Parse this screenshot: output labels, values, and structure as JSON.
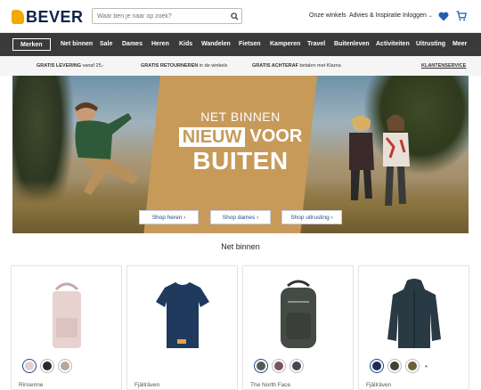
{
  "header": {
    "logo_text": "BEVER",
    "search_placeholder": "Waar ben je naar op zoek?",
    "links": [
      "Onze winkels",
      "Advies & Inspiratie",
      "Inloggen"
    ],
    "icons": [
      "search-icon",
      "heart-icon",
      "cart-icon",
      "chevron-down-icon"
    ]
  },
  "mainnav": {
    "merken": "Merken",
    "items": [
      "Net binnen",
      "Sale",
      "Dames",
      "Heren",
      "Kids",
      "Wandelen",
      "Fietsen",
      "Kamperen",
      "Travel",
      "Buitenleven",
      "Activiteiten",
      "Uitrusting",
      "Meer"
    ]
  },
  "infobar": {
    "items": [
      {
        "bold": "GRATIS LEVERING",
        "rest": " vanaf 25,-"
      },
      {
        "bold": "GRATIS RETOURNEREN",
        "rest": " in de winkels"
      },
      {
        "bold": "GRATIS ACHTERAF",
        "rest": " betalen met Klarna"
      }
    ],
    "service": "KLANTENSERVICE"
  },
  "hero": {
    "line1": "NET BINNEN",
    "nieuw": "NIEUW",
    "voor": "VOOR",
    "line3": "BUITEN",
    "buttons": [
      "Shop heren ›",
      "Shop dames ›",
      "Shop uitrusting ›"
    ]
  },
  "products": {
    "title": "Net binnen",
    "cards": [
      {
        "brand": "Rinsenne",
        "image": "backpack-tote",
        "color": "#e8d2cf",
        "swatches": [
          "#e3cdcd",
          "#2a2a2a",
          "#b8a79b"
        ]
      },
      {
        "brand": "Fjällräven",
        "image": "t-shirt",
        "color": "#1f3a5c",
        "swatches": []
      },
      {
        "brand": "The North Face",
        "image": "backpack",
        "color": "#444a44",
        "swatches": [
          "#555a55",
          "#7a5360",
          "#4a4450"
        ]
      },
      {
        "brand": "Fjällräven",
        "image": "jacket",
        "color": "#2a3a44",
        "swatches": [
          "#1d2e55",
          "#3f4430",
          "#6a6040"
        ],
        "more": "•"
      }
    ]
  },
  "colors": {
    "nav_bg": "#3a3a3a",
    "brand_navy": "#0e2247",
    "accent_orange": "#f2a900",
    "link_blue": "#1f4a8a",
    "hero_panel": "#c79a5a"
  }
}
